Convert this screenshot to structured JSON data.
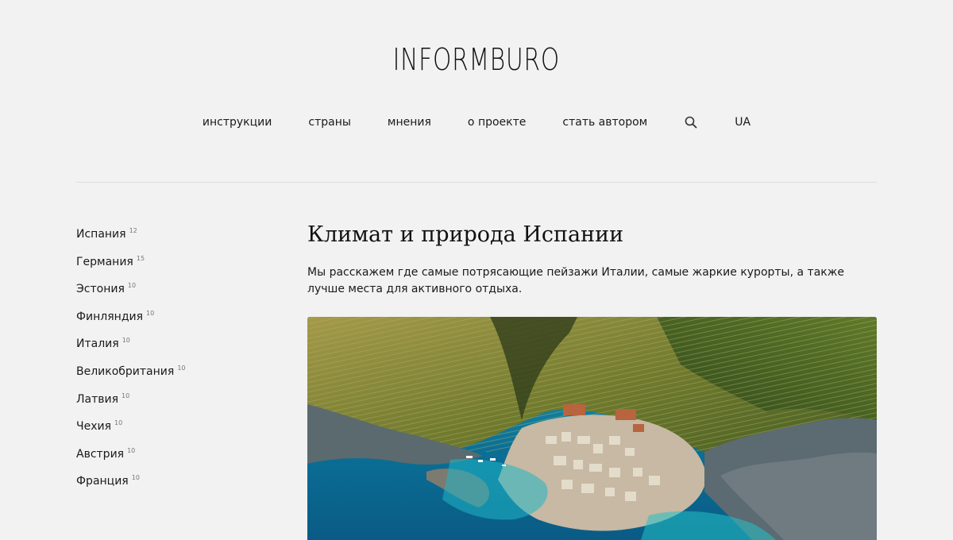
{
  "site": {
    "logo": "INFORMBURO"
  },
  "nav": {
    "items": [
      {
        "label": "инструкции",
        "name": "nav-instructions"
      },
      {
        "label": "страны",
        "name": "nav-countries"
      },
      {
        "label": "мнения",
        "name": "nav-opinions"
      },
      {
        "label": "о проекте",
        "name": "nav-about"
      },
      {
        "label": "стать автором",
        "name": "nav-become-author"
      }
    ],
    "search_icon": "search-icon",
    "language": "UA"
  },
  "sidebar": {
    "countries": [
      {
        "name": "Испания",
        "count": "12"
      },
      {
        "name": "Германия",
        "count": "15"
      },
      {
        "name": "Эстония",
        "count": "10"
      },
      {
        "name": "Финляндия",
        "count": "10"
      },
      {
        "name": "Италия",
        "count": "10"
      },
      {
        "name": "Великобритания",
        "count": "10"
      },
      {
        "name": "Латвия",
        "count": "10"
      },
      {
        "name": "Чехия",
        "count": "10"
      },
      {
        "name": "Австрия",
        "count": "10"
      },
      {
        "name": "Франция",
        "count": "10"
      }
    ]
  },
  "article": {
    "title": "Климат и природа Испании",
    "intro": "Мы расскажем где самые потрясающие пейзажи Италии, самые жаркие курорты, а также лучше места для активного отдыха."
  },
  "colors": {
    "background": "#f2f2f2",
    "text": "#1a1a1a",
    "count": "#777777",
    "divider": "#dcdcdc"
  }
}
